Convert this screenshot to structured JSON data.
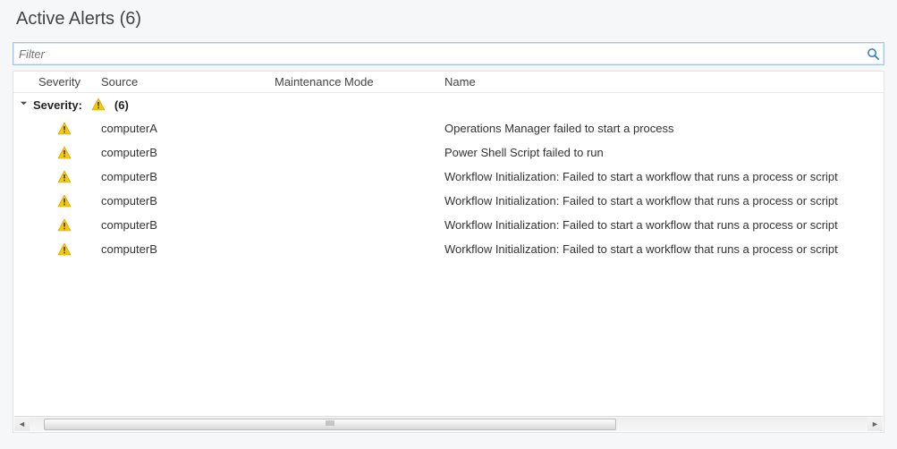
{
  "header": {
    "title_prefix": "Active Alerts",
    "count_suffix": "(6)"
  },
  "filter": {
    "placeholder": "Filter",
    "value": ""
  },
  "columns": {
    "severity": "Severity",
    "source": "Source",
    "maintenance": "Maintenance Mode",
    "name": "Name"
  },
  "group": {
    "label": "Severity:",
    "count": "(6)"
  },
  "rows": [
    {
      "source": "computerA",
      "maintenance": "",
      "name": "Operations Manager failed to start a process"
    },
    {
      "source": "computerB",
      "maintenance": "",
      "name": "Power Shell Script failed to run"
    },
    {
      "source": "computerB",
      "maintenance": "",
      "name": "Workflow Initialization: Failed to start a workflow that runs a process or script"
    },
    {
      "source": "computerB",
      "maintenance": "",
      "name": "Workflow Initialization: Failed to start a workflow that runs a process or script"
    },
    {
      "source": "computerB",
      "maintenance": "",
      "name": "Workflow Initialization: Failed to start a workflow that runs a process or script"
    },
    {
      "source": "computerB",
      "maintenance": "",
      "name": "Workflow Initialization: Failed to start a workflow that runs a process or script"
    }
  ]
}
